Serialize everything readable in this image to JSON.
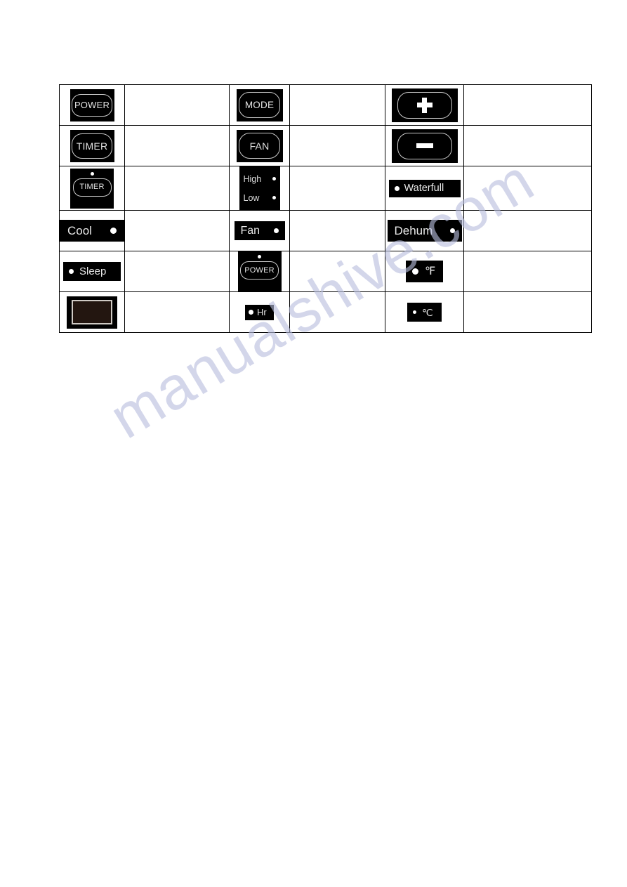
{
  "document": {
    "watermark": "manualshive.com"
  },
  "table": {
    "name": "control-panel-symbol-legend",
    "columns": [
      "symbol",
      "description",
      "symbol",
      "description",
      "symbol",
      "description"
    ],
    "rows": [
      {
        "cells": [
          {
            "type": "key",
            "icon": "power-button-icon",
            "label": "POWER",
            "description": ""
          },
          {
            "type": "description",
            "text": ""
          },
          {
            "type": "key",
            "icon": "mode-button-icon",
            "label": "MODE",
            "description": ""
          },
          {
            "type": "description",
            "text": ""
          },
          {
            "type": "key",
            "icon": "plus-button-icon",
            "label": "+",
            "description": ""
          },
          {
            "type": "description",
            "text": ""
          }
        ]
      },
      {
        "cells": [
          {
            "type": "key",
            "icon": "timer-button-icon",
            "label": "TIMER",
            "description": ""
          },
          {
            "type": "description",
            "text": ""
          },
          {
            "type": "key",
            "icon": "fan-button-icon",
            "label": "FAN",
            "description": ""
          },
          {
            "type": "description",
            "text": ""
          },
          {
            "type": "key",
            "icon": "minus-button-icon",
            "label": "−",
            "description": ""
          },
          {
            "type": "description",
            "text": ""
          }
        ]
      },
      {
        "cells": [
          {
            "type": "key-led",
            "icon": "timer-button-with-indicator-icon",
            "label": "TIMER",
            "description": ""
          },
          {
            "type": "description",
            "text": ""
          },
          {
            "type": "speed-indicator",
            "icon": "fan-speed-indicator-icon",
            "label_high": "High",
            "label_low": "Low",
            "description": ""
          },
          {
            "type": "description",
            "text": ""
          },
          {
            "type": "indicator-bar",
            "icon": "waterfull-indicator-icon",
            "label": "Waterfull",
            "led_side": "left",
            "description": ""
          },
          {
            "type": "description",
            "text": ""
          }
        ]
      },
      {
        "cells": [
          {
            "type": "indicator-bar",
            "icon": "cool-mode-indicator-icon",
            "label": "Cool",
            "led_side": "right",
            "description": ""
          },
          {
            "type": "description",
            "text": ""
          },
          {
            "type": "indicator-bar",
            "icon": "fan-mode-indicator-icon",
            "label": "Fan",
            "led_side": "right",
            "description": ""
          },
          {
            "type": "description",
            "text": ""
          },
          {
            "type": "indicator-bar",
            "icon": "dehum-mode-indicator-icon",
            "label": "Dehum",
            "led_side": "right",
            "description": ""
          },
          {
            "type": "description",
            "text": ""
          }
        ]
      },
      {
        "cells": [
          {
            "type": "indicator-bar",
            "icon": "sleep-mode-indicator-icon",
            "label": "Sleep",
            "led_side": "left",
            "description": ""
          },
          {
            "type": "description",
            "text": ""
          },
          {
            "type": "key-led",
            "icon": "power-button-with-indicator-icon",
            "label": "POWER",
            "description": ""
          },
          {
            "type": "description",
            "text": ""
          },
          {
            "type": "indicator-bar",
            "icon": "fahrenheit-indicator-icon",
            "label": "℉",
            "led_side": "left",
            "description": ""
          },
          {
            "type": "description",
            "text": ""
          }
        ]
      },
      {
        "cells": [
          {
            "type": "display",
            "icon": "led-display-window-icon",
            "label": "",
            "description": ""
          },
          {
            "type": "description",
            "text": ""
          },
          {
            "type": "indicator-bar",
            "icon": "hour-indicator-icon",
            "label": "Hr",
            "led_side": "left",
            "description": ""
          },
          {
            "type": "description",
            "text": ""
          },
          {
            "type": "indicator-bar",
            "icon": "celsius-indicator-icon",
            "label": "℃",
            "led_side": "left",
            "description": ""
          },
          {
            "type": "description",
            "text": ""
          }
        ]
      }
    ]
  },
  "colors": {
    "tile_background": "#000000",
    "key_outline": "#c9c9c9",
    "text": "#e4e4e4",
    "led": "#ffffff",
    "display_screen": "#231610",
    "display_frame": "#cfcac4",
    "table_border": "#000000",
    "watermark": "#b9bede"
  }
}
